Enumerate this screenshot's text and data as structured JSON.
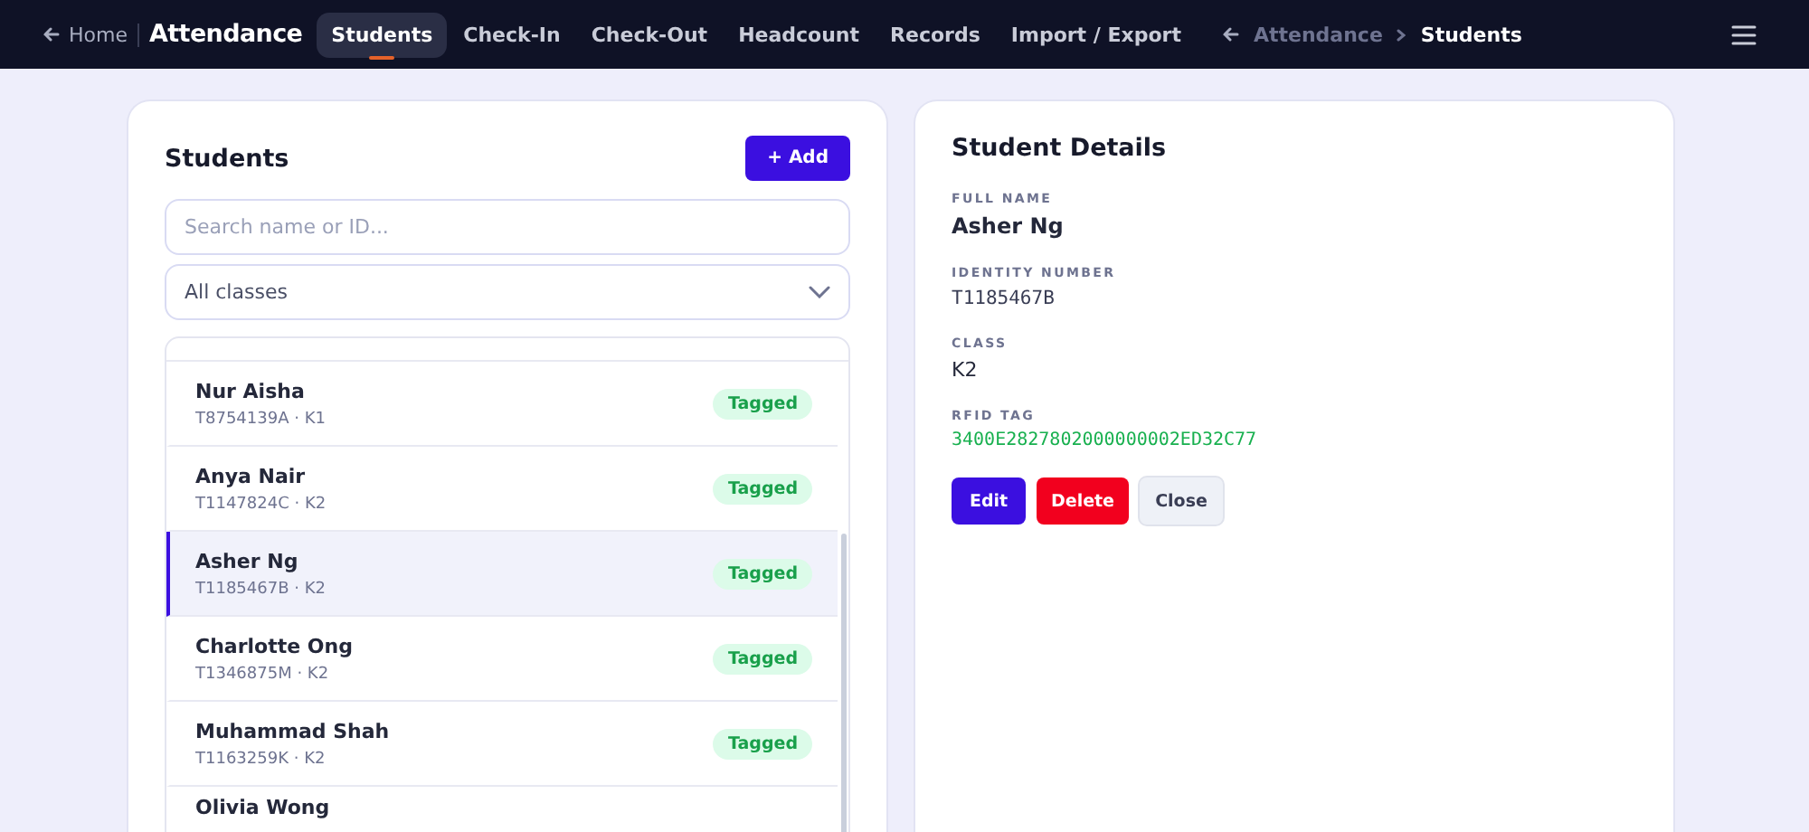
{
  "nav": {
    "back": "Home",
    "brand": "Attendance",
    "tabs": [
      {
        "label": "Students",
        "selected": true
      },
      {
        "label": "Check-In",
        "selected": false
      },
      {
        "label": "Check-Out",
        "selected": false
      },
      {
        "label": "Headcount",
        "selected": false
      },
      {
        "label": "Records",
        "selected": false
      },
      {
        "label": "Import / Export",
        "selected": false
      }
    ],
    "breadcrumb": [
      "Attendance",
      "Students"
    ]
  },
  "students": {
    "title": "Students",
    "add_button": "+ Add",
    "search": {
      "placeholder": "Search name or ID..."
    },
    "class_filter": "All classes",
    "rows": [
      {
        "name": "Nur Aisha",
        "meta": "T8754139A · K1",
        "badge": "Tagged",
        "selected": false
      },
      {
        "name": "Anya Nair",
        "meta": "T1147824C · K2",
        "badge": "Tagged",
        "selected": false
      },
      {
        "name": "Asher Ng",
        "meta": "T1185467B · K2",
        "badge": "Tagged",
        "selected": true
      },
      {
        "name": "Charlotte Ong",
        "meta": "T1346875M · K2",
        "badge": "Tagged",
        "selected": false
      },
      {
        "name": "Muhammad Shah",
        "meta": "T1163259K · K2",
        "badge": "Tagged",
        "selected": false
      },
      {
        "name": "Olivia Wong",
        "selected": false
      }
    ]
  },
  "details": {
    "title": "Student Details",
    "fields": [
      {
        "label": "FULL NAME",
        "value": "Asher Ng",
        "kind": "name"
      },
      {
        "label": "IDENTITY NUMBER",
        "value": "T1185467B",
        "kind": "mono"
      },
      {
        "label": "CLASS",
        "value": "K2",
        "kind": "plain"
      },
      {
        "label": "RFID TAG",
        "value": "3400E2827802000000002ED32C77",
        "kind": "tag"
      }
    ],
    "buttons": [
      {
        "label": "Edit",
        "kind": "primary"
      },
      {
        "label": "Delete",
        "kind": "danger"
      },
      {
        "label": "Close",
        "kind": "secondary"
      }
    ]
  }
}
